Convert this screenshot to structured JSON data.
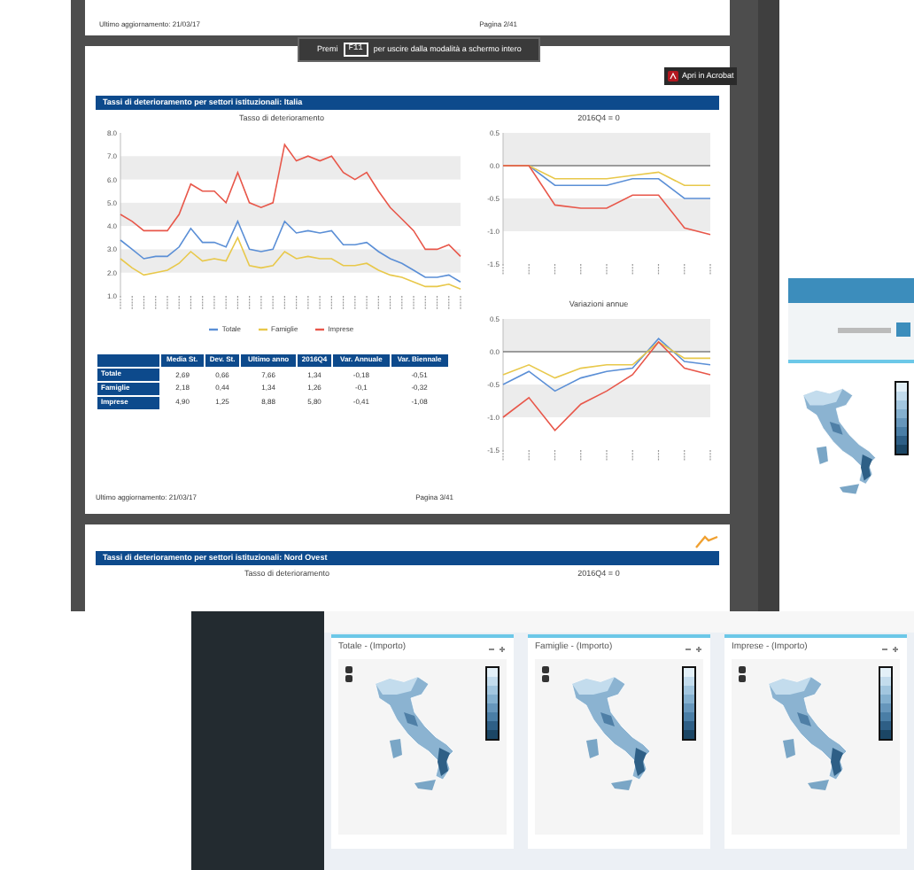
{
  "pdf_viewer": {
    "prev_page_footer": {
      "left": "Ultimo aggiornamento: 21/03/17",
      "right": "Pagina 2/41"
    },
    "fullscreen_hint": {
      "before": "Premi",
      "key": "F11",
      "after": "per uscire dalla modalità a schermo intero"
    },
    "acrobat_button": "Apri in Acrobat",
    "page": {
      "title": "Tassi di deterioramento per settori istituzionali: Italia",
      "main_chart": {
        "chart_data": {
          "type": "line",
          "title": "Tasso di deterioramento",
          "yticks": [
            {
              "value": 1,
              "label": "1.0"
            },
            {
              "value": 2,
              "label": "2.0"
            },
            {
              "value": 3,
              "label": "3.0"
            },
            {
              "value": 4,
              "label": "4.0"
            },
            {
              "value": 5,
              "label": "5.0"
            },
            {
              "value": 6,
              "label": "6.0"
            },
            {
              "value": 7,
              "label": "7.0"
            },
            {
              "value": 8,
              "label": "8.0"
            }
          ],
          "ylim": [
            1,
            8
          ],
          "series": [
            {
              "name": "Totale",
              "color": "#5b8fd6",
              "values": [
                3.4,
                3.0,
                2.6,
                2.7,
                2.7,
                3.1,
                3.9,
                3.3,
                3.3,
                3.1,
                4.2,
                3.0,
                2.9,
                3.0,
                4.2,
                3.7,
                3.8,
                3.7,
                3.8,
                3.2,
                3.2,
                3.3,
                2.9,
                2.6,
                2.4,
                2.1,
                1.8,
                1.8,
                1.9,
                1.6
              ]
            },
            {
              "name": "Famiglie",
              "color": "#e8c84a",
              "values": [
                2.6,
                2.2,
                1.9,
                2.0,
                2.1,
                2.4,
                2.9,
                2.5,
                2.6,
                2.5,
                3.5,
                2.3,
                2.2,
                2.3,
                2.9,
                2.6,
                2.7,
                2.6,
                2.6,
                2.3,
                2.3,
                2.4,
                2.1,
                1.9,
                1.8,
                1.6,
                1.4,
                1.4,
                1.5,
                1.3
              ]
            },
            {
              "name": "Imprese",
              "color": "#e8574a",
              "values": [
                4.5,
                4.2,
                3.8,
                3.8,
                3.8,
                4.5,
                5.8,
                5.5,
                5.5,
                5.0,
                6.3,
                5.0,
                4.8,
                5.0,
                7.5,
                6.8,
                7.0,
                6.8,
                7.0,
                6.3,
                6.0,
                6.3,
                5.5,
                4.8,
                4.3,
                3.8,
                3.0,
                3.0,
                3.2,
                2.7
              ]
            }
          ]
        }
      },
      "table": {
        "columns": [
          "Media St.",
          "Dev. St.",
          "Ultimo anno",
          "2016Q4",
          "Var. Annuale",
          "Var. Biennale"
        ],
        "rows": [
          {
            "label": "Totale",
            "cells": [
              "2,69",
              "0,66",
              "7,66",
              "1,34",
              "-0,18",
              "-0,51"
            ]
          },
          {
            "label": "Famiglie",
            "cells": [
              "2,18",
              "0,44",
              "1,34",
              "1,26",
              "-0,1",
              "-0,32"
            ]
          },
          {
            "label": "Imprese",
            "cells": [
              "4,90",
              "1,25",
              "8,88",
              "5,80",
              "-0,41",
              "-1,08"
            ]
          }
        ]
      },
      "side_charts": [
        {
          "chart_data": {
            "type": "line",
            "title": "2016Q4 = 0",
            "yticks": [
              {
                "value": -1.5,
                "label": "-1.5"
              },
              {
                "value": -1,
                "label": "-1.0"
              },
              {
                "value": -0.5,
                "label": "-0.5"
              },
              {
                "value": 0,
                "label": "0.0"
              },
              {
                "value": 0.5,
                "label": "0.5"
              }
            ],
            "ylim": [
              -1.5,
              0.5
            ],
            "series": [
              {
                "color": "#5b8fd6",
                "values": [
                  0,
                  0,
                  -0.3,
                  -0.3,
                  -0.3,
                  -0.2,
                  -0.2,
                  -0.5,
                  -0.5
                ]
              },
              {
                "color": "#e8c84a",
                "values": [
                  0,
                  0,
                  -0.2,
                  -0.2,
                  -0.2,
                  -0.15,
                  -0.1,
                  -0.3,
                  -0.3
                ]
              },
              {
                "color": "#e8574a",
                "values": [
                  0,
                  0,
                  -0.6,
                  -0.65,
                  -0.65,
                  -0.45,
                  -0.45,
                  -0.95,
                  -1.05
                ]
              }
            ]
          }
        },
        {
          "chart_data": {
            "type": "line",
            "title": "Variazioni annue",
            "yticks": [
              {
                "value": -1.5,
                "label": "-1.5"
              },
              {
                "value": -1,
                "label": "-1.0"
              },
              {
                "value": -0.5,
                "label": "-0.5"
              },
              {
                "value": 0,
                "label": "0.0"
              },
              {
                "value": 0.5,
                "label": "0.5"
              }
            ],
            "ylim": [
              -1.5,
              0.5
            ],
            "series": [
              {
                "color": "#5b8fd6",
                "values": [
                  -0.5,
                  -0.3,
                  -0.6,
                  -0.4,
                  -0.3,
                  -0.25,
                  0.2,
                  -0.15,
                  -0.2
                ]
              },
              {
                "color": "#e8c84a",
                "values": [
                  -0.35,
                  -0.2,
                  -0.4,
                  -0.25,
                  -0.2,
                  -0.2,
                  0.15,
                  -0.1,
                  -0.1
                ]
              },
              {
                "color": "#e8574a",
                "values": [
                  -1.0,
                  -0.7,
                  -1.2,
                  -0.8,
                  -0.6,
                  -0.35,
                  0.15,
                  -0.25,
                  -0.35
                ]
              }
            ]
          }
        }
      ],
      "footer": {
        "left": "Ultimo aggiornamento: 21/03/17",
        "right": "Pagina 3/41"
      }
    },
    "next_page": {
      "title": "Tassi di deterioramento per settori istituzionali: Nord Ovest",
      "chart_titles": [
        "Tasso di deterioramento",
        "2016Q4 = 0"
      ]
    }
  },
  "map_panels": [
    {
      "title": "Totale - (Importo)"
    },
    {
      "title": "Famiglie - (Importo)"
    },
    {
      "title": "Imprese - (Importo)"
    }
  ]
}
